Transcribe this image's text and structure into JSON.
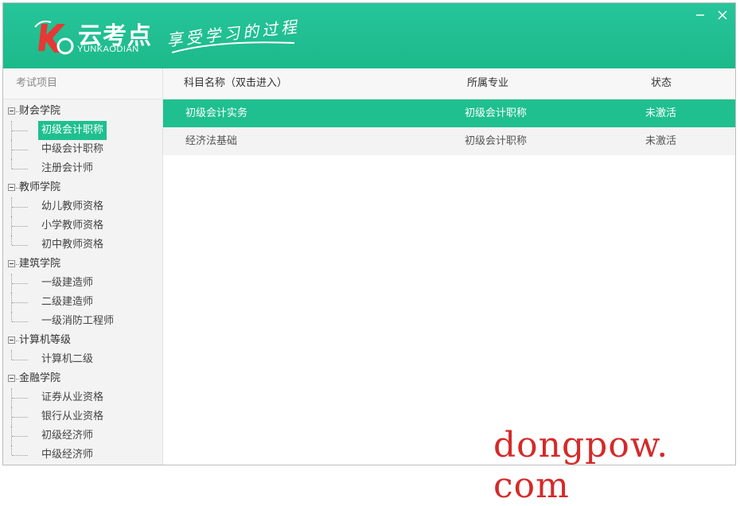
{
  "header": {
    "brand_name": "云考点",
    "brand_sub": "YUNKAODIAN",
    "slogan": "享受学习的过程",
    "minimize_icon": "minimize-icon",
    "close_icon": "close-icon",
    "accent_color": "#1fbf8f"
  },
  "sidebar": {
    "title": "考试项目",
    "groups": [
      {
        "label": "财会学院",
        "items": [
          "初级会计职称",
          "中级会计职称",
          "注册会计师"
        ]
      },
      {
        "label": "教师学院",
        "items": [
          "幼儿教师资格",
          "小学教师资格",
          "初中教师资格"
        ]
      },
      {
        "label": "建筑学院",
        "items": [
          "一级建造师",
          "二级建造师",
          "一级消防工程师"
        ]
      },
      {
        "label": "计算机等级",
        "items": [
          "计算机二级"
        ]
      },
      {
        "label": "金融学院",
        "items": [
          "证券从业资格",
          "银行从业资格",
          "初级经济师",
          "中级经济师"
        ]
      }
    ],
    "selected": "初级会计职称"
  },
  "table": {
    "columns": [
      "科目名称（双击进入）",
      "所属专业",
      "状态"
    ],
    "rows": [
      [
        "初级会计实务",
        "初级会计职称",
        "未激活"
      ],
      [
        "经济法基础",
        "初级会计职称",
        "未激活"
      ]
    ]
  },
  "watermark": "dongpow. com"
}
